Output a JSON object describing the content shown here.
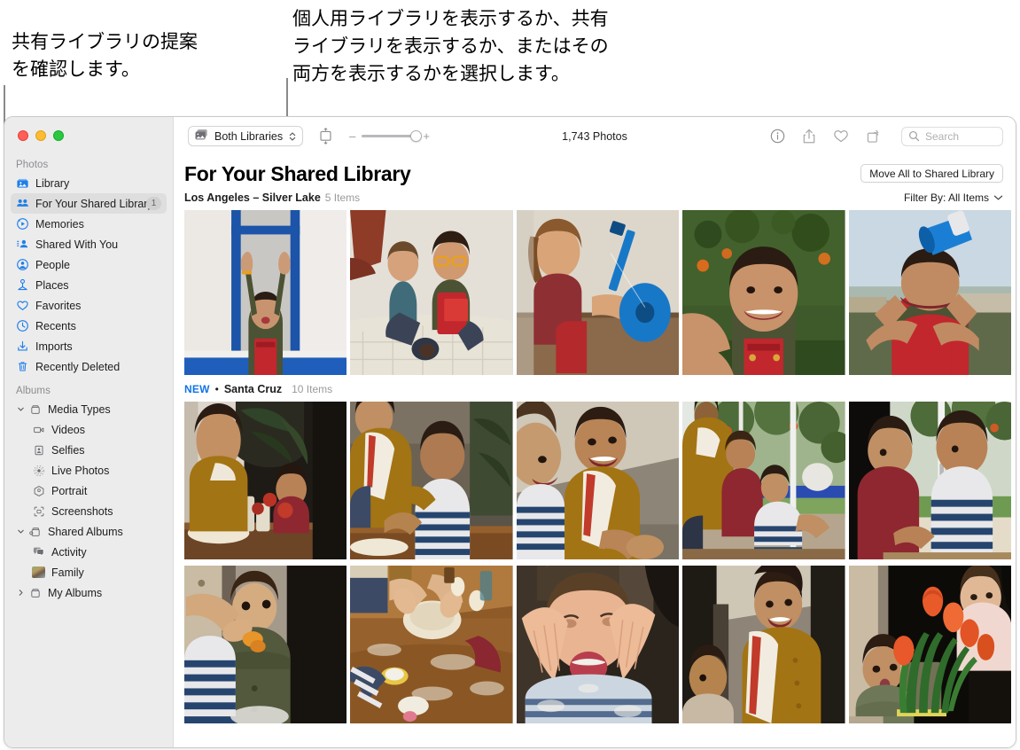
{
  "annotations": {
    "left_callout": "共有ライブラリの提案\nを確認します。",
    "right_callout": "個人用ライブラリを表示するか、共有\nライブラリを表示するか、またはその\n両方を表示するかを選択します。"
  },
  "window": {
    "traffic_lights": {
      "close_color": "#ff5f57",
      "minimize_color": "#febc2e",
      "zoom_color": "#28c840"
    }
  },
  "sidebar": {
    "sections": [
      {
        "title": "Photos",
        "items": [
          {
            "label": "Library",
            "icon": "library-icon",
            "selected": false,
            "badge": ""
          },
          {
            "label": "For Your Shared Library",
            "icon": "shared-library-icon",
            "selected": true,
            "badge": "1"
          },
          {
            "label": "Memories",
            "icon": "memories-icon",
            "selected": false,
            "badge": ""
          },
          {
            "label": "Shared With You",
            "icon": "shared-with-you-icon",
            "selected": false,
            "badge": ""
          },
          {
            "label": "People",
            "icon": "people-icon",
            "selected": false,
            "badge": ""
          },
          {
            "label": "Places",
            "icon": "places-icon",
            "selected": false,
            "badge": ""
          },
          {
            "label": "Favorites",
            "icon": "heart-icon",
            "selected": false,
            "badge": ""
          },
          {
            "label": "Recents",
            "icon": "clock-icon",
            "selected": false,
            "badge": ""
          },
          {
            "label": "Imports",
            "icon": "import-icon",
            "selected": false,
            "badge": ""
          },
          {
            "label": "Recently Deleted",
            "icon": "trash-icon",
            "selected": false,
            "badge": ""
          }
        ]
      },
      {
        "title": "Albums",
        "items": [
          {
            "label": "Media Types",
            "icon": "folder-icon",
            "disclosure": "down",
            "indent": 0
          },
          {
            "label": "Videos",
            "icon": "video-icon",
            "indent": 1
          },
          {
            "label": "Selfies",
            "icon": "selfie-icon",
            "indent": 1
          },
          {
            "label": "Live Photos",
            "icon": "live-photo-icon",
            "indent": 1
          },
          {
            "label": "Portrait",
            "icon": "portrait-icon",
            "indent": 1
          },
          {
            "label": "Screenshots",
            "icon": "screenshot-icon",
            "indent": 1
          },
          {
            "label": "Shared Albums",
            "icon": "shared-folder-icon",
            "disclosure": "down",
            "indent": 0
          },
          {
            "label": "Activity",
            "icon": "activity-icon",
            "indent": 1
          },
          {
            "label": "Family",
            "icon": "family-album-thumbnail",
            "indent": 1
          },
          {
            "label": "My Albums",
            "icon": "folder-icon",
            "disclosure": "right",
            "indent": 0
          }
        ]
      }
    ]
  },
  "toolbar": {
    "library_popup_label": "Both Libraries",
    "library_popup_icon": "photo-stack-icon",
    "aspect_button_icon": "aspect-ratio-icon",
    "zoom_out_label": "–",
    "zoom_in_label": "+",
    "zoom_value": 100,
    "photo_count": "1,743 Photos",
    "info_icon": "info-icon",
    "share_icon": "share-icon",
    "favorite_icon": "heart-icon",
    "rotate_icon": "rotate-icon",
    "search_icon": "search-icon",
    "search_placeholder": "Search",
    "search_value": ""
  },
  "content": {
    "page_title": "For Your Shared Library",
    "move_all_button": "Move All to Shared Library",
    "filter_by_label": "Filter By: All Items",
    "filter_chevron_icon": "chevron-down-icon",
    "sections": [
      {
        "new_badge": "",
        "location": "Los Angeles – Silver Lake",
        "item_count": "5 Items",
        "rows": [
          [
            "photo-kid-window-blue",
            "photo-two-boys-bed",
            "photo-girl-guitar",
            "photo-boy-outdoors",
            "photo-boy-megaphone"
          ]
        ]
      },
      {
        "new_badge": "NEW",
        "separator": "•",
        "location": "Santa Cruz",
        "item_count": "10 Items",
        "rows": [
          [
            "photo-kitchen-plants",
            "photo-mother-child-baking",
            "photo-mother-smiling",
            "photo-family-window",
            "photo-two-boys-window"
          ],
          [
            "photo-boy-eating",
            "photo-dough-flour-table",
            "photo-boy-floury-face",
            "photo-mother-towel",
            "photo-tulips-baby"
          ]
        ]
      }
    ]
  },
  "colors": {
    "accent": "#1274e6",
    "sidebar_bg": "#ececed",
    "selected_row": "#dededf"
  }
}
